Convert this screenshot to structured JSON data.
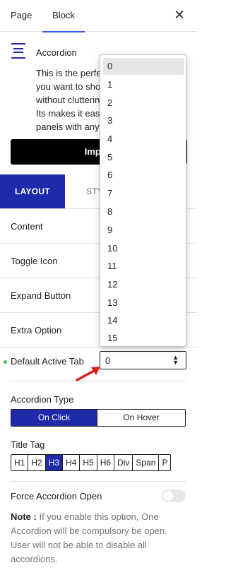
{
  "top_tabs": {
    "page": "Page",
    "block": "Block",
    "close": "✕"
  },
  "block": {
    "title": "Accordion",
    "description": "This is the perfe… you want to sho… without clutterin… Its makes it easy… panels with any…",
    "description_lines": [
      "This is the perfe",
      "you want to sho",
      "without clutterin",
      "Its makes it easy",
      "panels with any"
    ],
    "import_label": "Import"
  },
  "tabs": {
    "layout": "LAYOUT",
    "style": "STY"
  },
  "panels": [
    "Content",
    "Toggle Icon",
    "Expand Button",
    "Extra Option"
  ],
  "default_active_tab": {
    "label": "Default Active Tab",
    "value": "0",
    "arrows": "⬍"
  },
  "dropdown_options": [
    "0",
    "1",
    "2",
    "3",
    "4",
    "5",
    "6",
    "7",
    "8",
    "9",
    "10",
    "11",
    "12",
    "13",
    "14",
    "15"
  ],
  "accordion_type": {
    "label": "Accordion Type",
    "options": [
      "On Click",
      "On Hover"
    ],
    "selected": "On Click"
  },
  "title_tag": {
    "label": "Title Tag",
    "options": [
      "H1",
      "H2",
      "H3",
      "H4",
      "H5",
      "H6",
      "Div",
      "Span",
      "P"
    ],
    "selected": "H3"
  },
  "force_open": {
    "label": "Force Accordion Open",
    "enabled": false,
    "note_prefix": "Note :",
    "note_text": " If you enable this option, One Accordion will be compulsory be open. User will not be able to disable all accordions."
  },
  "colors": {
    "accent": "#1f2aaa",
    "annotation_arrow": "#d9221c",
    "status_dot": "#4ab866"
  }
}
